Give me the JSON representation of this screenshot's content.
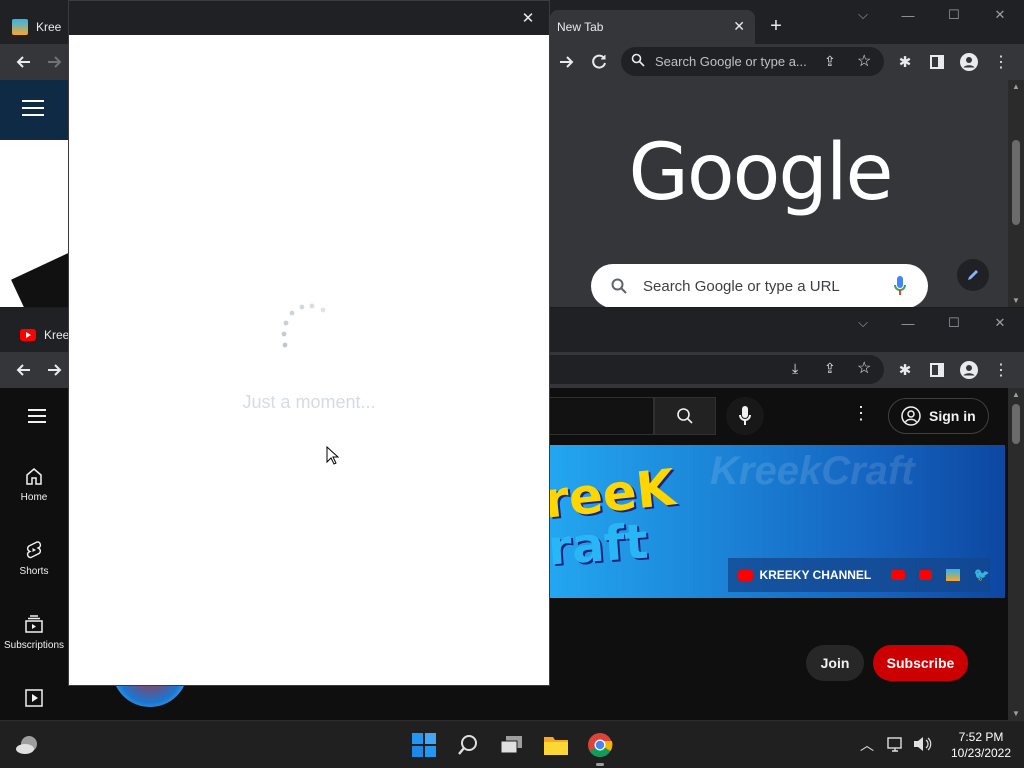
{
  "top_browser": {
    "left_tab_title": "Kree",
    "new_tab_title": "New Tab",
    "omnibox_placeholder": "Search Google or type a...",
    "google_logo": "Google",
    "ntp_search_placeholder": "Search Google or type a URL"
  },
  "bottom_browser": {
    "tab_title": "Kree",
    "sidebar": [
      {
        "label": "Home",
        "icon": "home-icon"
      },
      {
        "label": "Shorts",
        "icon": "shorts-icon"
      },
      {
        "label": "Subscriptions",
        "icon": "subscriptions-icon"
      },
      {
        "label": "",
        "icon": "library-icon"
      }
    ],
    "sign_in_label": "Sign in",
    "banner": {
      "logo_line1": "reeK",
      "logo_line2": "raft",
      "channel_label": "KREEKY CHANNEL",
      "watermark": "KreekCraft"
    },
    "join_label": "Join",
    "subscribe_label": "Subscribe"
  },
  "dialog": {
    "loading_text": "Just a moment..."
  },
  "taskbar": {
    "time": "7:52 PM",
    "date": "10/23/2022"
  },
  "colors": {
    "chrome_dark": "#202124",
    "toolbar": "#35363a",
    "youtube_red": "#cc0000",
    "banner_blue": "#1e88e5"
  }
}
